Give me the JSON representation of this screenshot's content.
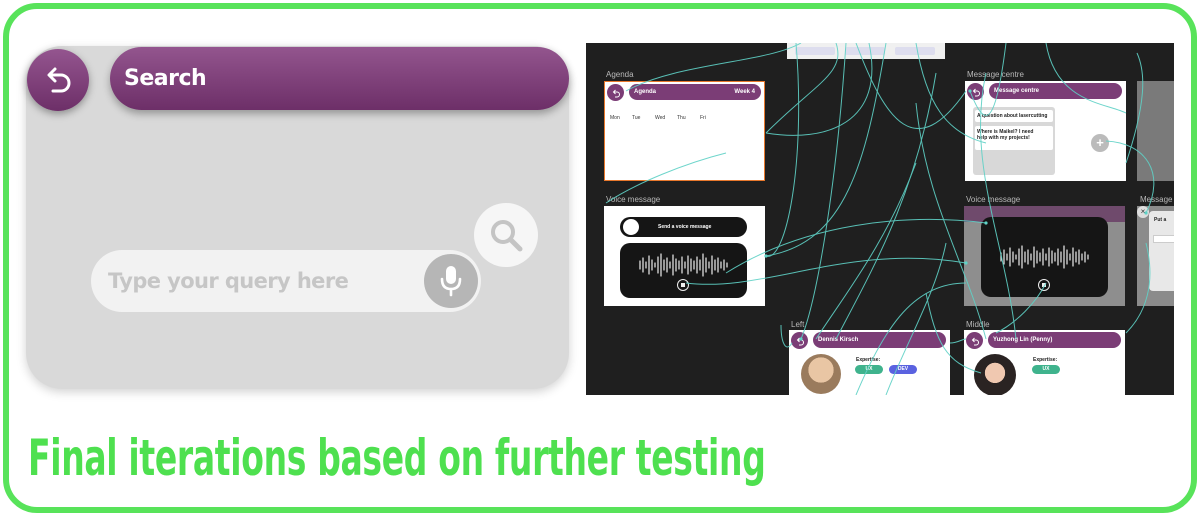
{
  "left_mockup": {
    "search_title": "Search",
    "query_placeholder": "Type your query here"
  },
  "flow": {
    "agenda": {
      "frame_label": "Agenda",
      "title": "Agenda",
      "week": "Week 4",
      "days": [
        "Mon",
        "Tue",
        "Wed",
        "Thu",
        "Fri"
      ]
    },
    "message_centre": {
      "frame_label": "Message centre",
      "title": "Message centre",
      "messages": [
        "A question about lasercutting",
        "Where is Maikel? I need help with my projects!"
      ]
    },
    "voice_message_1": {
      "frame_label": "Voice message",
      "title": "Send a voice message"
    },
    "voice_message_2": {
      "frame_label": "Voice message"
    },
    "message_partial": {
      "frame_label": "Message c",
      "text": "Put a"
    },
    "left_profile": {
      "frame_label": "Left",
      "name": "Dennis Kirsch",
      "expertise_label": "Expertise:",
      "chips": [
        "UX",
        "DEV"
      ]
    },
    "middle_profile": {
      "frame_label": "Middle",
      "name": "Yuzhong Lin (Penny)",
      "expertise_label": "Expertise:",
      "chips": [
        "UX"
      ]
    }
  },
  "caption": "Final iterations based on further testing",
  "colors": {
    "border": "#58e35a",
    "caption": "#4ee04f",
    "purple": "#7b3d76",
    "canvas": "#1f1f1f",
    "wire": "#5fd1c6"
  },
  "icons": {
    "back": "undo-arrow-icon",
    "mic": "microphone-icon",
    "search": "magnifier-icon"
  }
}
